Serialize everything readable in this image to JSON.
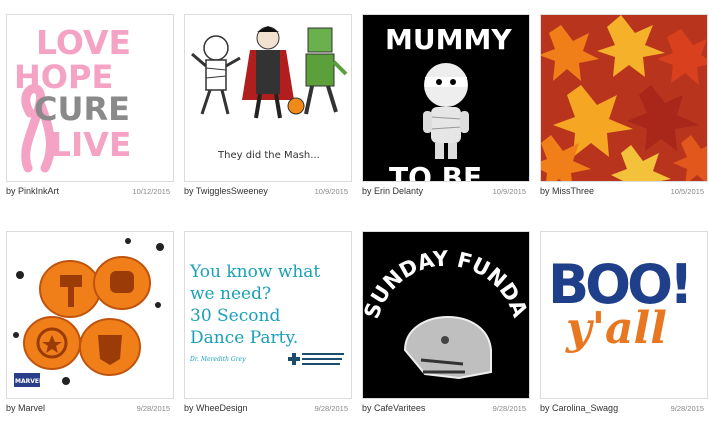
{
  "cards": [
    {
      "by": "by",
      "user": "PinkInkArt",
      "date": "10/12/2015",
      "art": {
        "lines": [
          "LOVE",
          "HOPE",
          "CURE",
          "LIVE"
        ],
        "pink": "#f4a3c4",
        "gray": "#8a8a8a"
      }
    },
    {
      "by": "by",
      "user": "TwigglesSweeney",
      "date": "10/9/2015",
      "art": {
        "caption": "They did the Mash..."
      }
    },
    {
      "by": "by",
      "user": "Erin Delanty",
      "date": "10/9/2015",
      "art": {
        "top": "MUMMY",
        "bottom": "TO BE"
      }
    },
    {
      "by": "by",
      "user": "MissThree",
      "date": "10/5/2015",
      "art": {
        "colors": [
          "#d9411e",
          "#f07f1a",
          "#f5b12a",
          "#a8261a"
        ]
      }
    },
    {
      "by": "by",
      "user": "Marvel",
      "date": "9/28/2015",
      "art": {
        "logo": "MARVEL"
      }
    },
    {
      "by": "by",
      "user": "WheeDesign",
      "date": "9/28/2015",
      "art": {
        "lines": [
          "You know what",
          "we need?",
          "30 Second",
          "Dance Party."
        ],
        "signature": "Dr. Meredith Grey"
      }
    },
    {
      "by": "by",
      "user": "CafeVaritees",
      "date": "9/28/2015",
      "art": {
        "top": "SUNDAY FUNDAY"
      }
    },
    {
      "by": "by",
      "user": "Carolina_Swagg",
      "date": "9/28/2015",
      "art": {
        "boo": "BOO!",
        "yall": "y'all",
        "blue": "#1f3f8a",
        "orange": "#e87722"
      }
    }
  ]
}
